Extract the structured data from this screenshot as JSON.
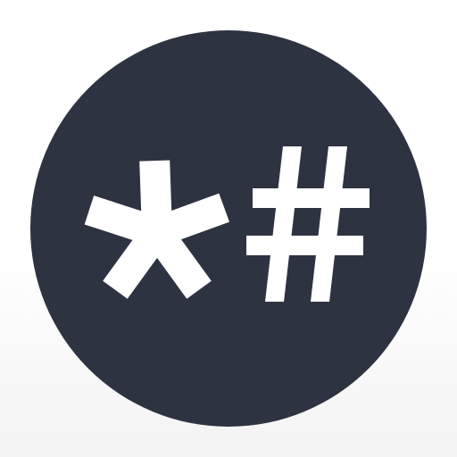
{
  "icon": {
    "name": "asterisk-hash-icon",
    "glyphs": [
      "asterisk",
      "hash"
    ]
  },
  "colors": {
    "background_top": "#ffffff",
    "background_bottom": "#f3f3f3",
    "circle": "#2e3341",
    "glyph": "#ffffff"
  }
}
